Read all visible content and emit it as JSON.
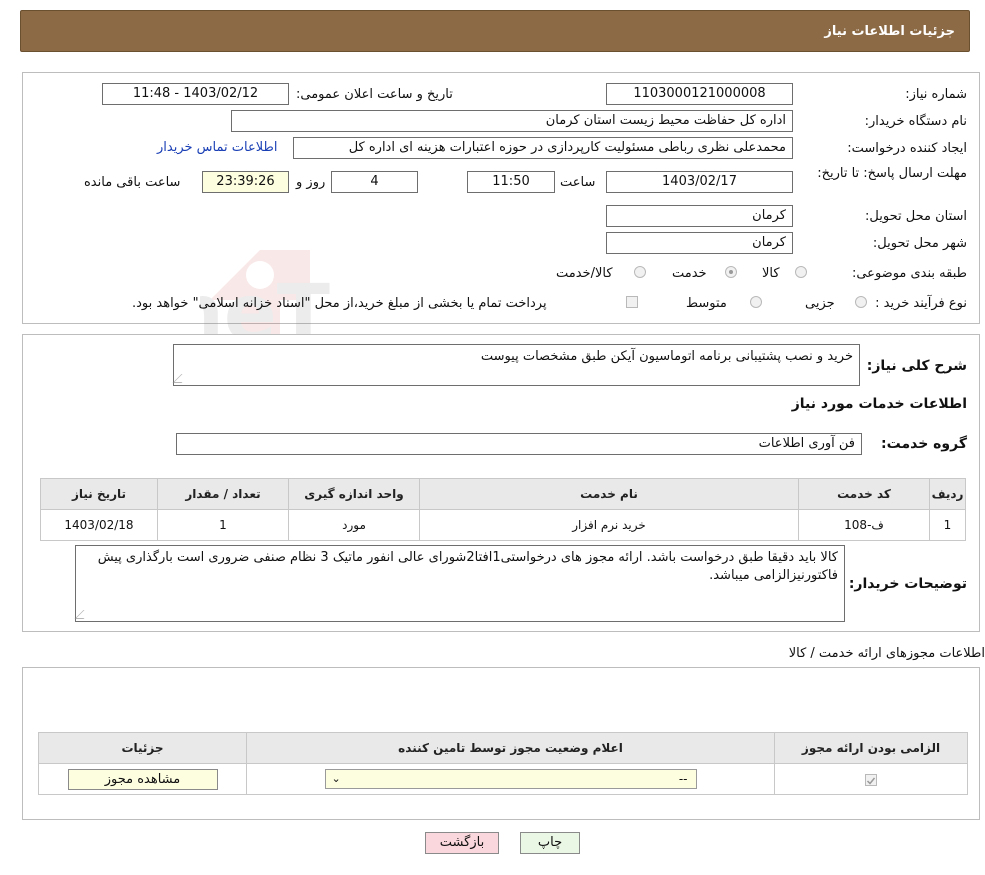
{
  "header": {
    "title": "جزئیات اطلاعات نیاز"
  },
  "form": {
    "need_number_label": "شماره نیاز:",
    "need_number": "1103000121000008",
    "announce_label": "تاریخ و ساعت اعلان عمومی:",
    "announce_value": "1403/02/12 - 11:48",
    "buyer_org_label": "نام دستگاه خریدار:",
    "buyer_org": "اداره کل حفاظت محیط زیست استان کرمان",
    "creator_label": "ایجاد کننده درخواست:",
    "creator": "محمدعلی نظری رباطی مسئولیت کارپردازی در حوزه اعتبارات هزینه ای اداره کل",
    "contact_link": "اطلاعات تماس خریدار",
    "deadline_label": "مهلت ارسال پاسخ: تا تاریخ:",
    "deadline_date": "1403/02/17",
    "time_label": "ساعت",
    "deadline_time": "11:50",
    "days_value": "4",
    "days_label": "روز و",
    "remaining_time": "23:39:26",
    "remaining_label": "ساعت باقی مانده",
    "province_label": "استان محل تحویل:",
    "province": "کرمان",
    "city_label": "شهر محل تحویل:",
    "city": "کرمان",
    "category_label": "طبقه بندی موضوعی:",
    "category_options": [
      "کالا",
      "خدمت",
      "کالا/خدمت"
    ],
    "category_selected": "خدمت",
    "process_label": "نوع فرآیند خرید :",
    "process_options": [
      "جزیی",
      "متوسط"
    ],
    "payment_note": "پرداخت تمام یا بخشی از مبلغ خرید،از محل \"اسناد خزانه اسلامی\" خواهد بود."
  },
  "details": {
    "summary_label": "شرح کلی نیاز:",
    "summary": "خرید و نصب پشتیبانی برنامه اتوماسیون آیکن طبق مشخصات پیوست",
    "services_title": "اطلاعات خدمات مورد نیاز",
    "service_group_label": "گروه خدمت:",
    "service_group": "فن آوری اطلاعات",
    "table_headers": [
      "ردیف",
      "کد خدمت",
      "نام خدمت",
      "واحد اندازه گیری",
      "تعداد / مقدار",
      "تاریخ نیاز"
    ],
    "table_rows": [
      [
        "1",
        "ف-108",
        "خرید نرم افزار",
        "مورد",
        "1",
        "1403/02/18"
      ]
    ],
    "buyer_notes_label": "توضیحات خریدار:",
    "buyer_notes": "کالا باید دقیقا طبق درخواست باشد. ارائه مجوز های درخواستی1افتا2شورای عالی انفور ماتیک 3 نظام صنفی ضروری است بارگذاری پیش فاکتورنیزالزامی میباشد."
  },
  "permits": {
    "title": "اطلاعات مجوزهای ارائه خدمت / کالا",
    "headers": [
      "الزامی بودن ارائه مجوز",
      "اعلام وضعیت مجوز توسط تامین کننده",
      "جزئیات"
    ],
    "select_value": "--",
    "view_button": "مشاهده مجوز"
  },
  "actions": {
    "print": "چاپ",
    "back": "بازگشت"
  },
  "watermark": "AriaTender.neT",
  "colors": {
    "header_bg": "#8b6a45",
    "link": "#1a3fb5",
    "back_btn": "#f9d7dc",
    "print_btn": "#eaf7e4",
    "view_btn": "#fdfde0",
    "select_bg": "#fdfde0"
  }
}
